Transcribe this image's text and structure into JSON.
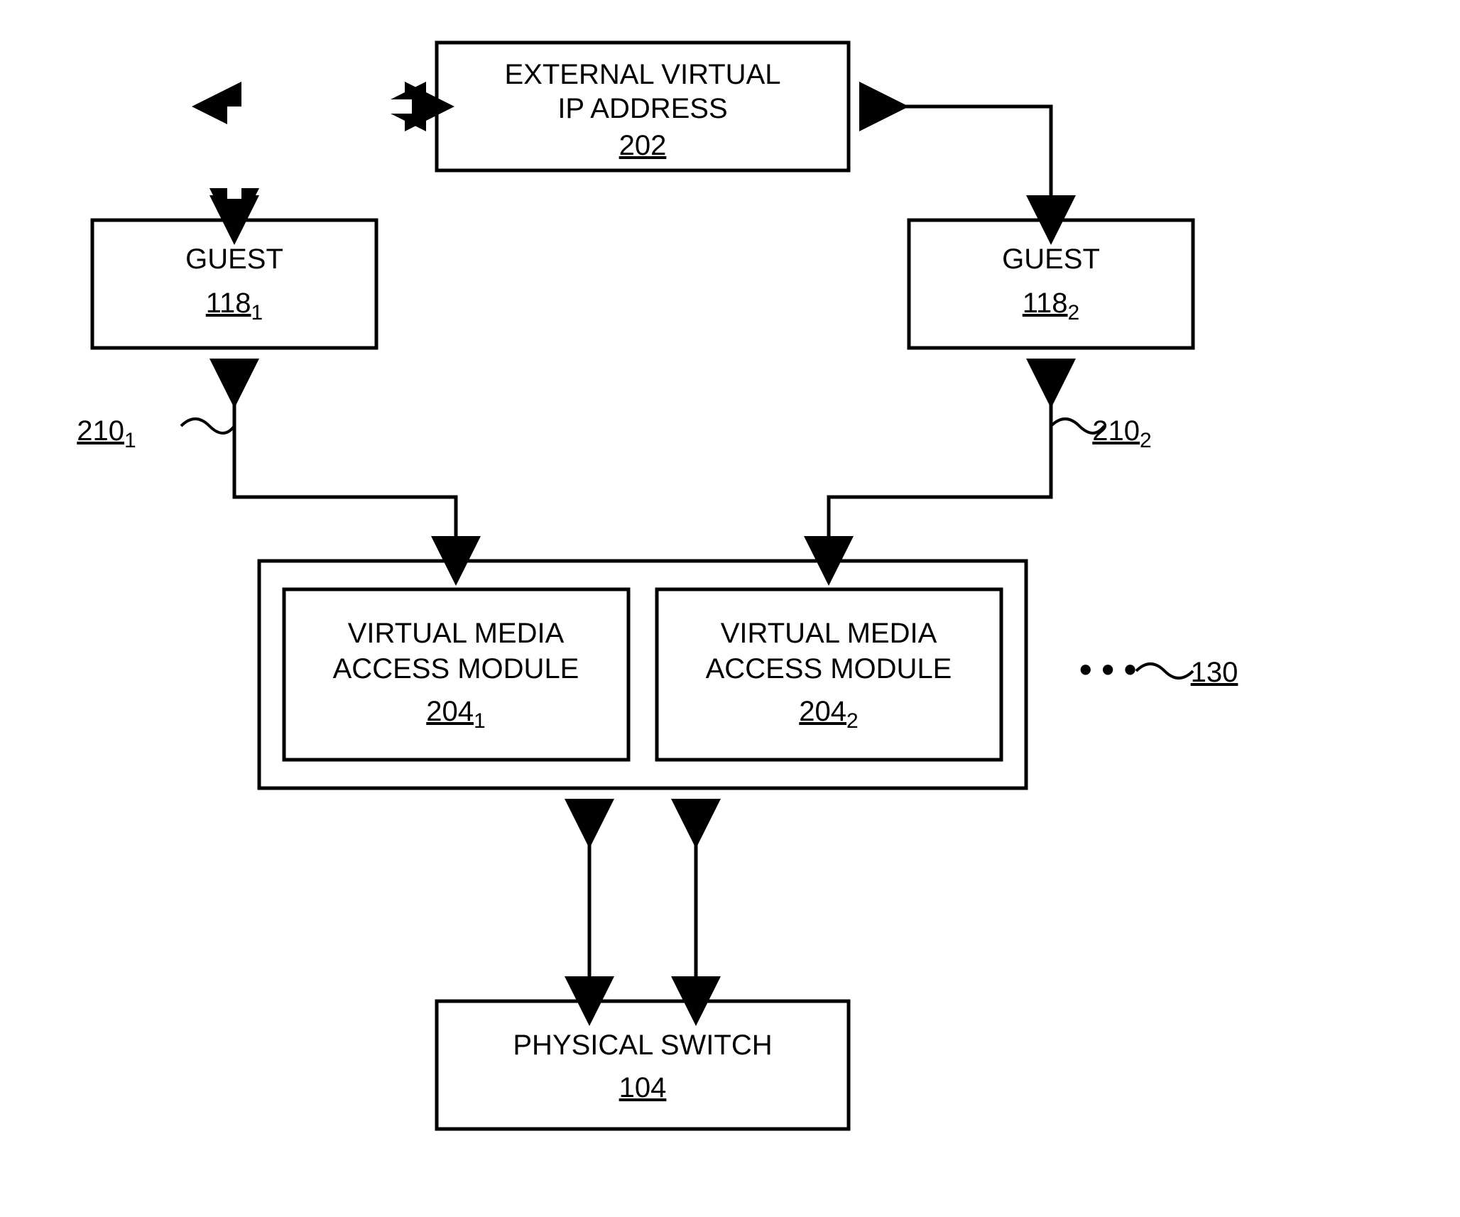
{
  "blocks": {
    "top": {
      "line1": "EXTERNAL VIRTUAL",
      "line2": "IP ADDRESS",
      "ref": "202"
    },
    "guest1": {
      "label": "GUEST",
      "ref": "118",
      "sub": "1"
    },
    "guest2": {
      "label": "GUEST",
      "ref": "118",
      "sub": "2"
    },
    "vmam1": {
      "line1": "VIRTUAL MEDIA",
      "line2": "ACCESS MODULE",
      "ref": "204",
      "sub": "1"
    },
    "vmam2": {
      "line1": "VIRTUAL MEDIA",
      "line2": "ACCESS MODULE",
      "ref": "204",
      "sub": "2"
    },
    "container_ref": "130",
    "ellipsis": "•  •  •",
    "switch": {
      "label": "PHYSICAL SWITCH",
      "ref": "104"
    }
  },
  "connector_labels": {
    "left": {
      "ref": "210",
      "sub": "1"
    },
    "right": {
      "ref": "210",
      "sub": "2"
    }
  }
}
